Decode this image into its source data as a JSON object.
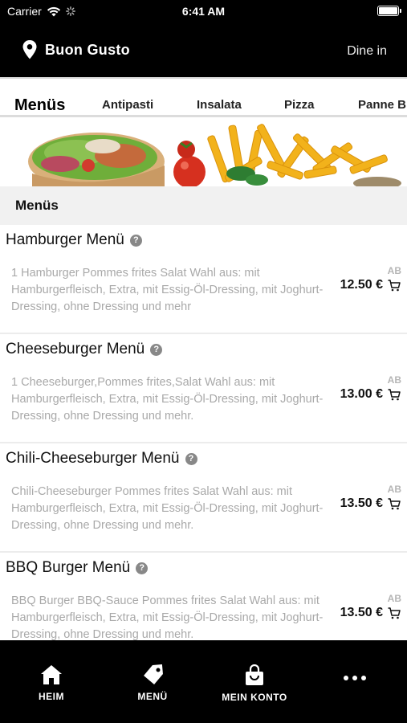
{
  "status_bar": {
    "carrier": "Carrier",
    "time": "6:41 AM"
  },
  "header": {
    "restaurant": "Buon Gusto",
    "mode": "Dine in"
  },
  "tabs": [
    {
      "label": "Menüs",
      "active": true
    },
    {
      "label": "Antipasti",
      "active": false
    },
    {
      "label": "Insalata",
      "active": false
    },
    {
      "label": "Pizza",
      "active": false
    },
    {
      "label": "Panne B",
      "active": false
    }
  ],
  "section": {
    "title": "Menüs"
  },
  "items": [
    {
      "name": "Hamburger Menü",
      "description": "1 Hamburger Pommes frites Salat Wahl aus: mit Hamburgerfleisch, Extra, mit Essig-Öl-Dressing, mit Joghurt-Dressing, ohne Dressing und mehr",
      "ab": "AB",
      "price": "12.50 €"
    },
    {
      "name": "Cheeseburger Menü",
      "description": "1 Cheeseburger,Pommes frites,Salat Wahl aus: mit Hamburgerfleisch, Extra, mit Essig-Öl-Dressing, mit Joghurt-Dressing, ohne Dressing und mehr.",
      "ab": "AB",
      "price": "13.00 €"
    },
    {
      "name": "Chili-Cheeseburger Menü",
      "description": "Chili-Cheeseburger Pommes frites Salat Wahl aus: mit Hamburgerfleisch, Extra, mit Essig-Öl-Dressing, mit Joghurt-Dressing, ohne Dressing und mehr.",
      "ab": "AB",
      "price": "13.50 €"
    },
    {
      "name": "BBQ Burger Menü",
      "description": "BBQ Burger BBQ-Sauce Pommes frites Salat Wahl aus: mit Hamburgerfleisch, Extra, mit Essig-Öl-Dressing, mit Joghurt-Dressing, ohne Dressing und mehr.",
      "ab": "AB",
      "price": "13.50 €"
    }
  ],
  "bottom_nav": [
    {
      "label": "HEIM",
      "icon": "home-icon"
    },
    {
      "label": "MENÜ",
      "icon": "tag-icon"
    },
    {
      "label": "MEIN KONTO",
      "icon": "shopping-bag-icon"
    },
    {
      "label": "",
      "icon": "more-icon"
    }
  ],
  "colors": {
    "header_bg": "#000000",
    "section_bg": "#f1f1f1",
    "description_text": "#a9a9a9",
    "price_text": "#111111"
  }
}
